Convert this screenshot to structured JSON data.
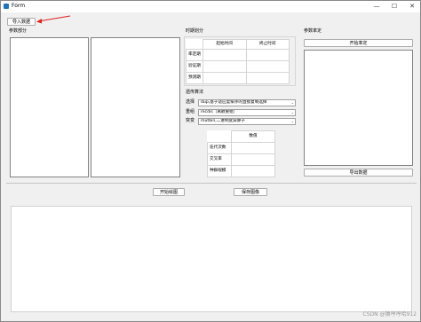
{
  "window": {
    "title": "Form",
    "minimize": "—",
    "maximize": "☐",
    "close": "✕"
  },
  "toolbar": {
    "import_label": "导入数据"
  },
  "params": {
    "title": "参数部分"
  },
  "period": {
    "title": "时期划分",
    "col_start": "起始时间",
    "col_end": "终止时间",
    "rows": [
      "率定期",
      "验证期",
      "预测期"
    ]
  },
  "algo": {
    "title": "遗传算法",
    "select_label": "选择",
    "select_value": "dup,基于适应度排序的直接复制选择",
    "recomb_label": "重组",
    "recomb_value": "recdis（离散重组）",
    "mutate_label": "突变",
    "mutate_value": "mutbin,二进制变异算子",
    "table_header": "数值",
    "table_rows": [
      "迭代次数",
      "交叉率",
      "种群规模"
    ]
  },
  "calib": {
    "title": "参数率定",
    "start_label": "开始率定",
    "export_label": "导出数据"
  },
  "actions": {
    "plot_label": "开始绘图",
    "save_label": "保存图像"
  },
  "watermark": "CSDN @猿哼哼哈912"
}
